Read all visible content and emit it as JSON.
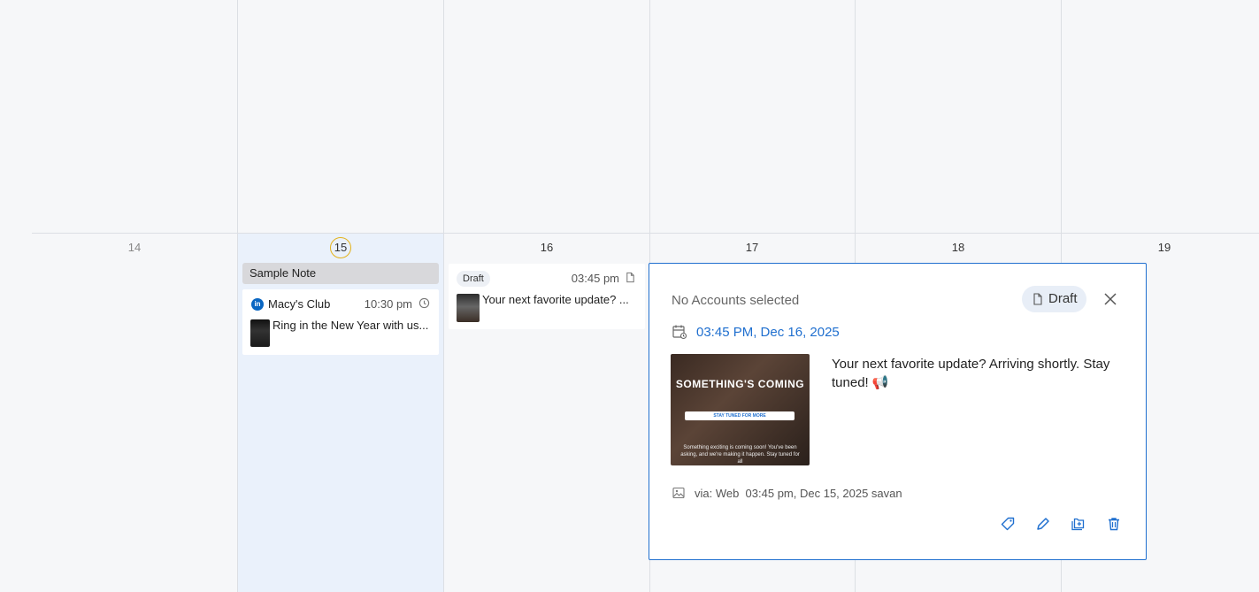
{
  "calendar": {
    "days": [
      {
        "num": "14",
        "today": false
      },
      {
        "num": "15",
        "today": true
      },
      {
        "num": "16",
        "today": false
      },
      {
        "num": "17",
        "today": false
      },
      {
        "num": "18",
        "today": false
      },
      {
        "num": "19",
        "today": false
      }
    ]
  },
  "note": {
    "label": "Sample Note"
  },
  "post1": {
    "account": "Macy's Club",
    "network_icon": "linkedin-icon",
    "time": "10:30 pm",
    "text": "Ring in the New Year with us..."
  },
  "post2": {
    "status": "Draft",
    "time": "03:45 pm",
    "text": "Your next favorite update? ..."
  },
  "popup": {
    "accounts": "No Accounts selected",
    "status": "Draft",
    "datetime": "03:45 PM, Dec 16, 2025",
    "image_title": "SOMETHING'S COMING",
    "image_search": "STAY TUNED FOR MORE",
    "image_body": "Something exciting is coming soon! You've been asking, and we're making it happen. Stay tuned for all",
    "body": "Your next favorite update? Arriving shortly. Stay tuned! 📢",
    "meta": "via: Web  03:45 pm, Dec 15, 2025 savan",
    "accent": "#1f6fcf"
  }
}
